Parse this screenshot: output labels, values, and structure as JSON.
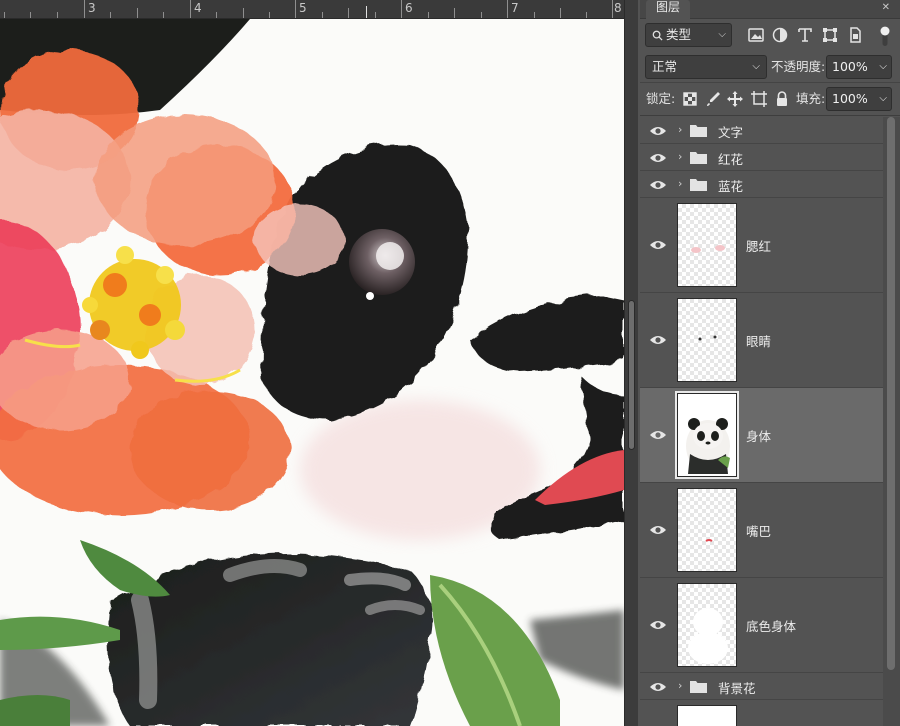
{
  "ruler": {
    "marks": [
      "3",
      "4",
      "5",
      "6",
      "7",
      "8"
    ]
  },
  "panel": {
    "tab_title": "图层",
    "filter": {
      "label": "类型"
    },
    "blend_mode": "正常",
    "opacity_label": "不透明度:",
    "opacity_value": "100%",
    "lock_label": "锁定:",
    "fill_label": "填充:",
    "fill_value": "100%"
  },
  "layers": [
    {
      "name": "文字",
      "kind": "group",
      "visible": true
    },
    {
      "name": "红花",
      "kind": "group",
      "visible": true
    },
    {
      "name": "蓝花",
      "kind": "group",
      "visible": true
    },
    {
      "name": "腮红",
      "kind": "layer",
      "visible": true,
      "selected": false
    },
    {
      "name": "眼睛",
      "kind": "layer",
      "visible": true,
      "selected": false
    },
    {
      "name": "身体",
      "kind": "layer",
      "visible": true,
      "selected": true
    },
    {
      "name": "嘴巴",
      "kind": "layer",
      "visible": true,
      "selected": false
    },
    {
      "name": "底色身体",
      "kind": "layer",
      "visible": true,
      "selected": false
    },
    {
      "name": "背景花",
      "kind": "group",
      "visible": true
    }
  ],
  "colors": {
    "panel_bg": "#535353",
    "selected_row": "#6a6a6a",
    "canvas_bg": "#fbfbf9"
  }
}
